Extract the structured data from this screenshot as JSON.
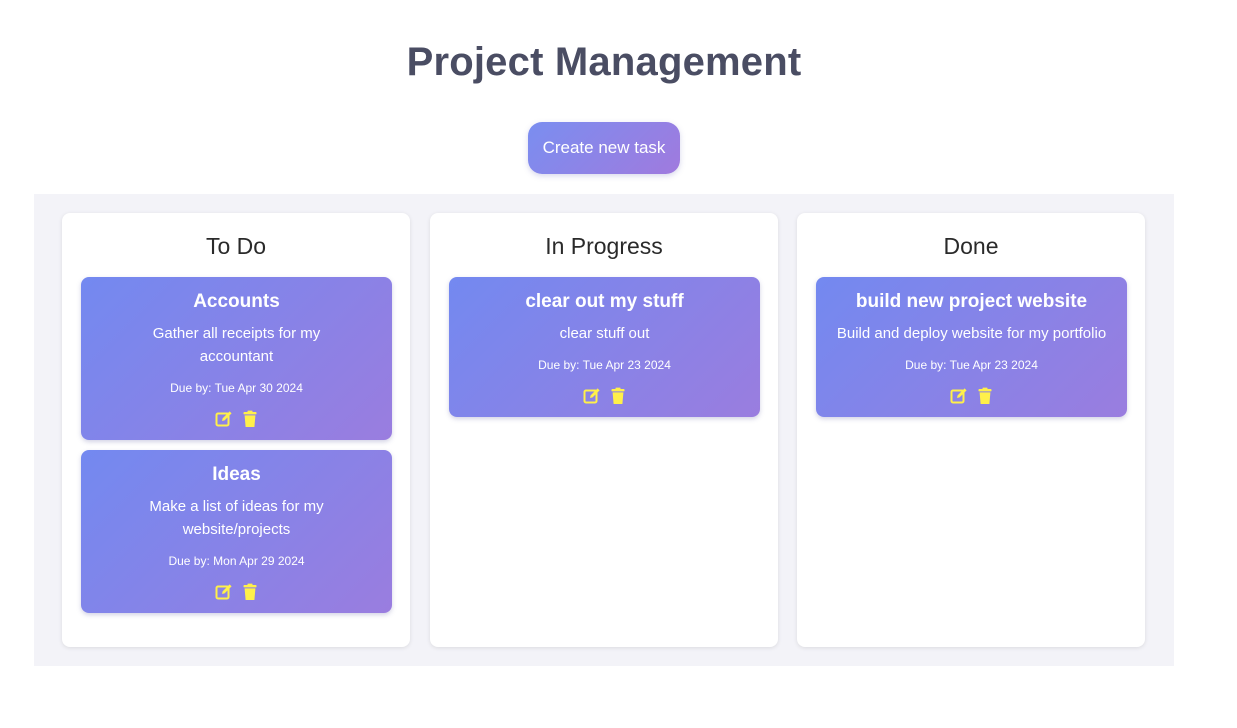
{
  "page": {
    "title": "Project Management",
    "create_button": "Create new task"
  },
  "colors": {
    "accent_start": "#7389f0",
    "accent_end": "#9a7ddf",
    "icon": "#fff04a",
    "title": "#4a4d63"
  },
  "columns": [
    {
      "title": "To Do",
      "cards": [
        {
          "title": "Accounts",
          "description": "Gather all receipts for my accountant",
          "due": "Due by: Tue Apr 30 2024"
        },
        {
          "title": "Ideas",
          "description": "Make a list of ideas for my website/projects",
          "due": "Due by: Mon Apr 29 2024"
        }
      ]
    },
    {
      "title": "In Progress",
      "cards": [
        {
          "title": "clear out my stuff",
          "description": "clear stuff out",
          "due": "Due by: Tue Apr 23 2024"
        }
      ]
    },
    {
      "title": "Done",
      "cards": [
        {
          "title": "build new project website",
          "description": "Build and deploy website for my portfolio",
          "due": "Due by: Tue Apr 23 2024"
        }
      ]
    }
  ],
  "icons": {
    "edit": "edit-icon",
    "delete": "trash-icon"
  }
}
